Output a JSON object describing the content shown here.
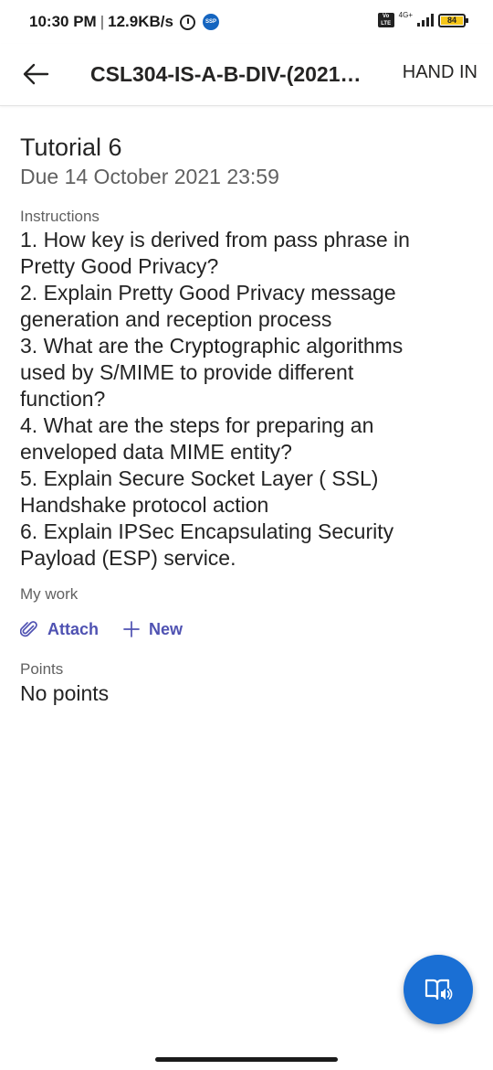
{
  "status_bar": {
    "time": "10:30 PM",
    "separator": "|",
    "speed": "12.9KB/s",
    "app_badge": "SSP",
    "volte": "Vo LTE",
    "network": "4G+",
    "battery": "84"
  },
  "header": {
    "title": "CSL304-IS-A-B-DIV-(2021…",
    "hand_in_label": "HAND IN",
    "back_icon": "arrow-left-icon"
  },
  "assignment": {
    "title": "Tutorial 6",
    "due": "Due 14 October 2021 23:59",
    "instructions_label": "Instructions",
    "instructions": [
      "1. How key is derived from pass phrase in",
      "Pretty Good Privacy?",
      "2. Explain Pretty Good Privacy message",
      "generation and reception process",
      "3. What are the Cryptographic algorithms",
      "used by S/MIME to provide different",
      "function?",
      "4. What are the steps for preparing an",
      "enveloped data MIME entity?",
      "5. Explain Secure Socket Layer ( SSL)",
      "Handshake protocol action",
      "6. Explain IPSec Encapsulating Security",
      "Payload (ESP) service."
    ],
    "my_work_label": "My work",
    "attach_label": "Attach",
    "new_label": "New",
    "points_label": "Points",
    "points_value": "No points"
  },
  "icons": {
    "attach": "paperclip-icon",
    "new": "plus-icon",
    "fab": "immersive-reader-icon"
  },
  "colors": {
    "accent": "#4f52b2",
    "fab": "#1a6fd4",
    "battery": "#f5c518"
  }
}
